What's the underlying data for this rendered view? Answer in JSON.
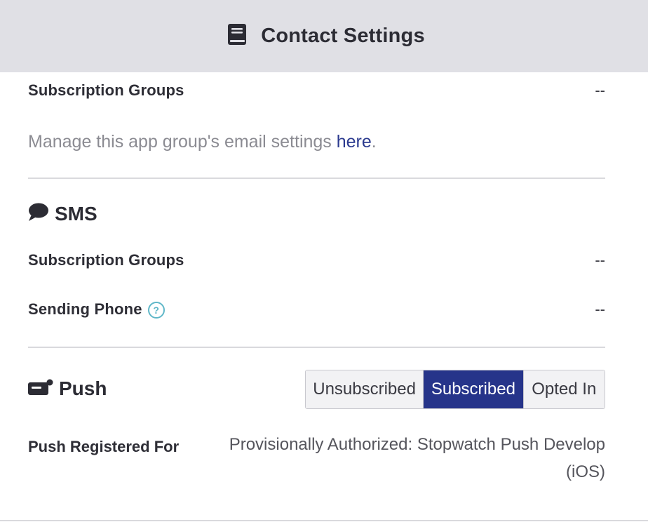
{
  "header": {
    "title": "Contact Settings",
    "icon": "book-icon"
  },
  "email": {
    "subscription_groups_label": "Subscription Groups",
    "subscription_groups_value": "--",
    "note_prefix": "Manage this app group's email settings ",
    "note_link": "here",
    "note_suffix": "."
  },
  "sms": {
    "title": "SMS",
    "icon": "chat-bubble-icon",
    "subscription_groups_label": "Subscription Groups",
    "subscription_groups_value": "--",
    "sending_phone_label": "Sending Phone",
    "sending_phone_help": "?",
    "sending_phone_value": "--"
  },
  "push": {
    "title": "Push",
    "icon": "push-notification-icon",
    "states": [
      "Unsubscribed",
      "Subscribed",
      "Opted In"
    ],
    "selected_state": "Subscribed",
    "registered_label": "Push Registered For",
    "registered_value_line1": "Provisionally Authorized: Stopwatch Push Develop",
    "registered_value_line2": "(iOS)"
  },
  "colors": {
    "accent": "#26348a",
    "link": "#2b3a8f",
    "header_bg": "#e0e0e5",
    "help": "#5fb7c8"
  }
}
